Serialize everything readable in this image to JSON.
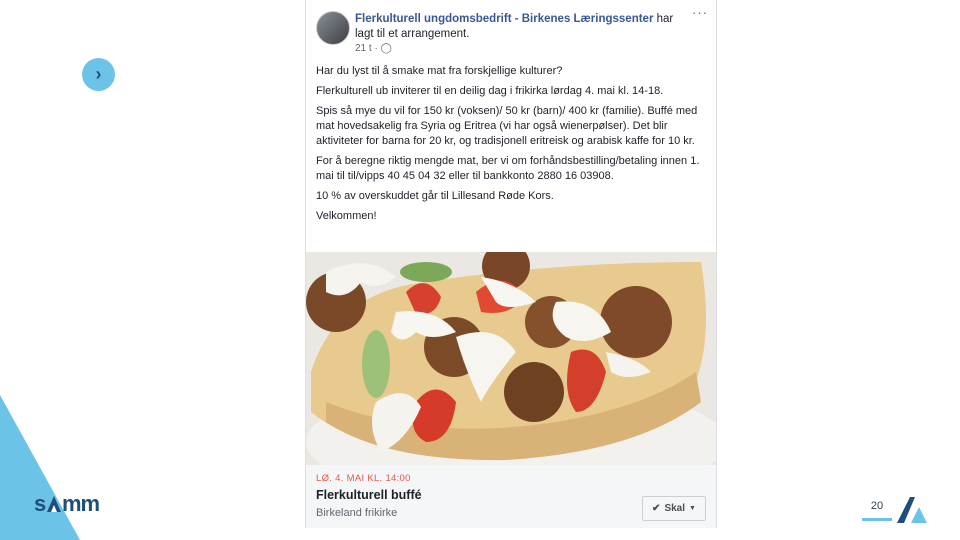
{
  "slide": {
    "page_number": "20",
    "next_icon": "chevron-right-icon",
    "logo_text": "samm",
    "colors": {
      "accent": "#6cc3e8",
      "dark": "#1d4f7a"
    }
  },
  "post": {
    "author": "Flerkulturell ungdomsbedrift - Birkenes Læringssenter",
    "action": " har lagt til et arrangement.",
    "meta": "21 t ·",
    "more": "···",
    "paragraphs": [
      "Har du lyst til å smake mat fra forskjellige kulturer?",
      "Flerkulturell ub inviterer til en deilig dag i frikirka lørdag 4. mai kl. 14-18.",
      "Spis så mye du vil for 150 kr (voksen)/ 50 kr (barn)/ 400 kr (familie). Buffé med mat hovedsakelig fra Syria og Eritrea (vi har også wienerpølser). Det blir aktiviteter for barna for 20 kr, og tradisjonell eritreisk og arabisk kaffe for 10 kr.",
      "For å beregne riktig mengde mat, ber vi om forhåndsbestilling/betaling innen 1. mai til til/vipps 40 45 04 32 eller til bankkonto 2880 16 03908.",
      "10 % av overskuddet går til Lillesand Røde Kors.",
      "Velkommen!"
    ],
    "event": {
      "date": "LØ. 4. MAI KL. 14:00",
      "title": "Flerkulturell buffé",
      "location": "Birkeland frikirke",
      "button_label": "Skal",
      "button_check": "✔",
      "button_caret": "▼"
    }
  }
}
